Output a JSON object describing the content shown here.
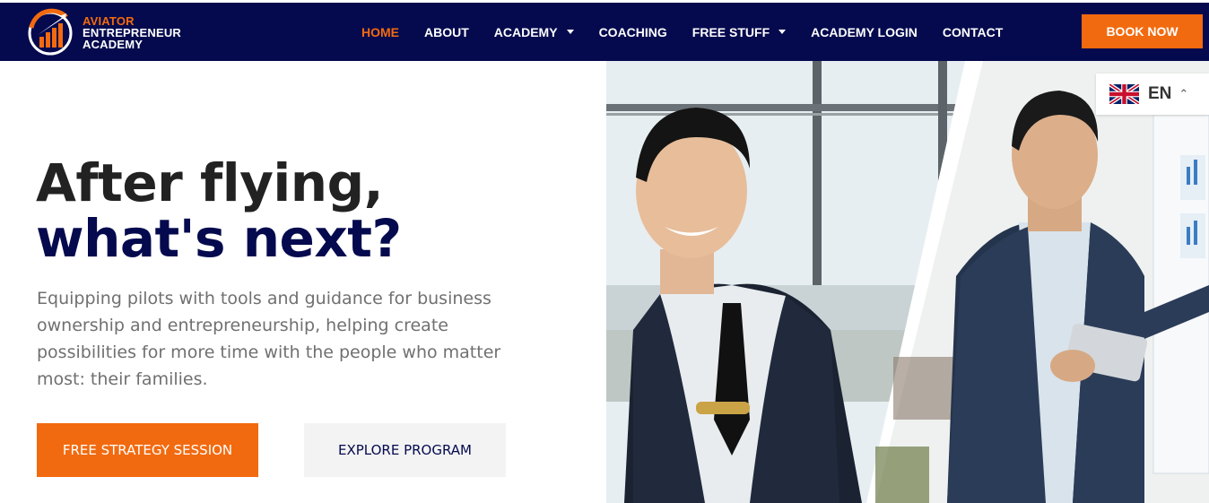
{
  "brand": {
    "line1": "AVIATOR",
    "line2": "ENTREPRENEUR",
    "line3": "ACADEMY",
    "accent_color": "#f26a0f",
    "nav_color": "#050a4e"
  },
  "nav": {
    "items": [
      {
        "label": "HOME",
        "active": true
      },
      {
        "label": "ABOUT"
      },
      {
        "label": "ACADEMY",
        "has_dropdown": true
      },
      {
        "label": "COACHING"
      },
      {
        "label": "FREE STUFF",
        "has_dropdown": true
      },
      {
        "label": "ACADEMY LOGIN"
      },
      {
        "label": "CONTACT"
      }
    ],
    "cta": "BOOK NOW"
  },
  "hero": {
    "title_line1": "After flying,",
    "title_line2": "what's next?",
    "lead": "Equipping pilots with tools and guidance for business ownership and entrepreneurship, helping create possibilities for more time with the people who matter most: their families.",
    "primary_button": "FREE STRATEGY SESSION",
    "secondary_button": "EXPLORE PROGRAM",
    "image_icon": "pilot-and-businessman-photo"
  },
  "language": {
    "code": "EN",
    "flag_icon": "uk-flag-icon",
    "chevron_icon": "chevron-up-icon"
  }
}
